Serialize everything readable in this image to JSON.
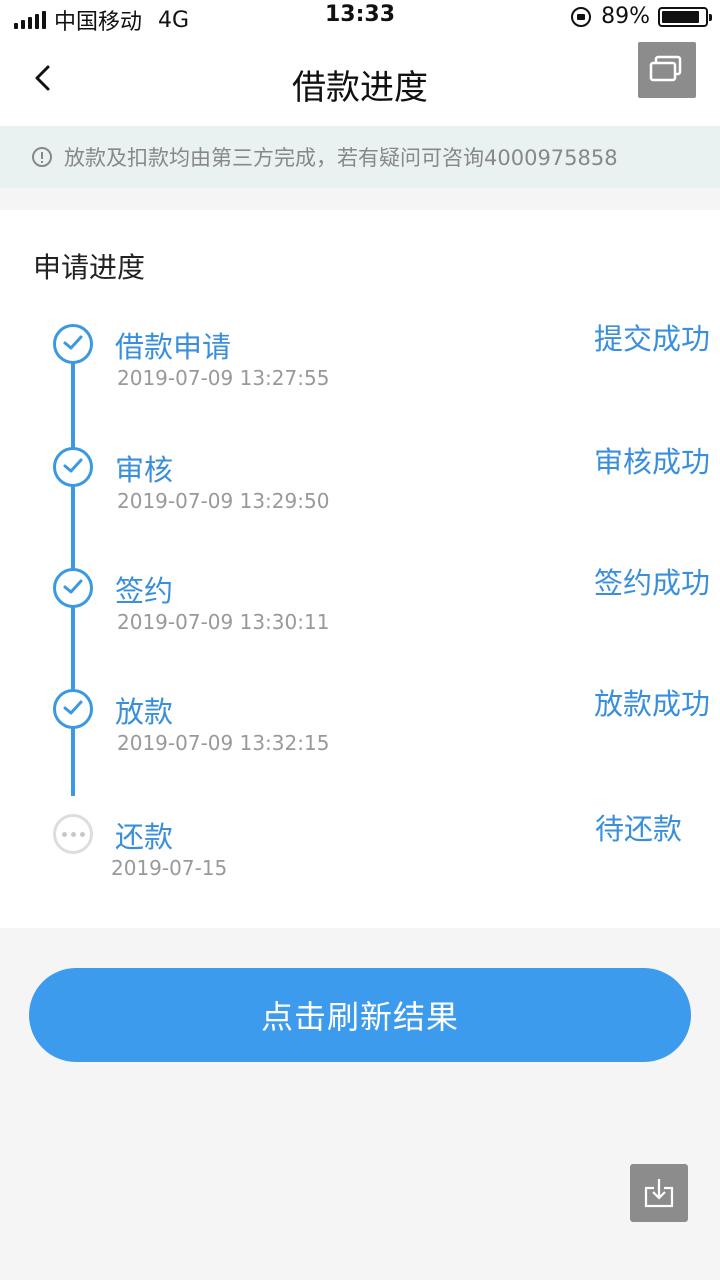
{
  "status_bar": {
    "carrier": "中国移动",
    "network": "4G",
    "time": "13:33",
    "battery": "89%",
    "battery_level": 0.89
  },
  "nav": {
    "title": "借款进度"
  },
  "notice": {
    "text": "放款及扣款均由第三方完成，若有疑问可咨询4000975858"
  },
  "progress": {
    "title": "申请进度",
    "steps": [
      {
        "name": "借款申请",
        "time": "2019-07-09 13:27:55",
        "status": "提交成功",
        "state": "done"
      },
      {
        "name": "审核",
        "time": "2019-07-09 13:29:50",
        "status": "审核成功",
        "state": "done"
      },
      {
        "name": "签约",
        "time": "2019-07-09 13:30:11",
        "status": "签约成功",
        "state": "done"
      },
      {
        "name": "放款",
        "time": "2019-07-09 13:32:15",
        "status": "放款成功",
        "state": "done"
      },
      {
        "name": "还款",
        "time": "2019-07-15",
        "status": "待还款",
        "state": "pending"
      }
    ]
  },
  "actions": {
    "refresh_label": "点击刷新结果"
  },
  "colors": {
    "accent": "#3a8fdc",
    "button": "#3d9bee",
    "notice_bg": "#e9f2f1"
  },
  "icons": {
    "back": "chevron-left-icon",
    "window": "window-overlap-icon",
    "notice": "info-circle-icon",
    "step_done": "check-circle-icon",
    "step_pending": "ellipsis-circle-icon",
    "download": "download-icon"
  }
}
